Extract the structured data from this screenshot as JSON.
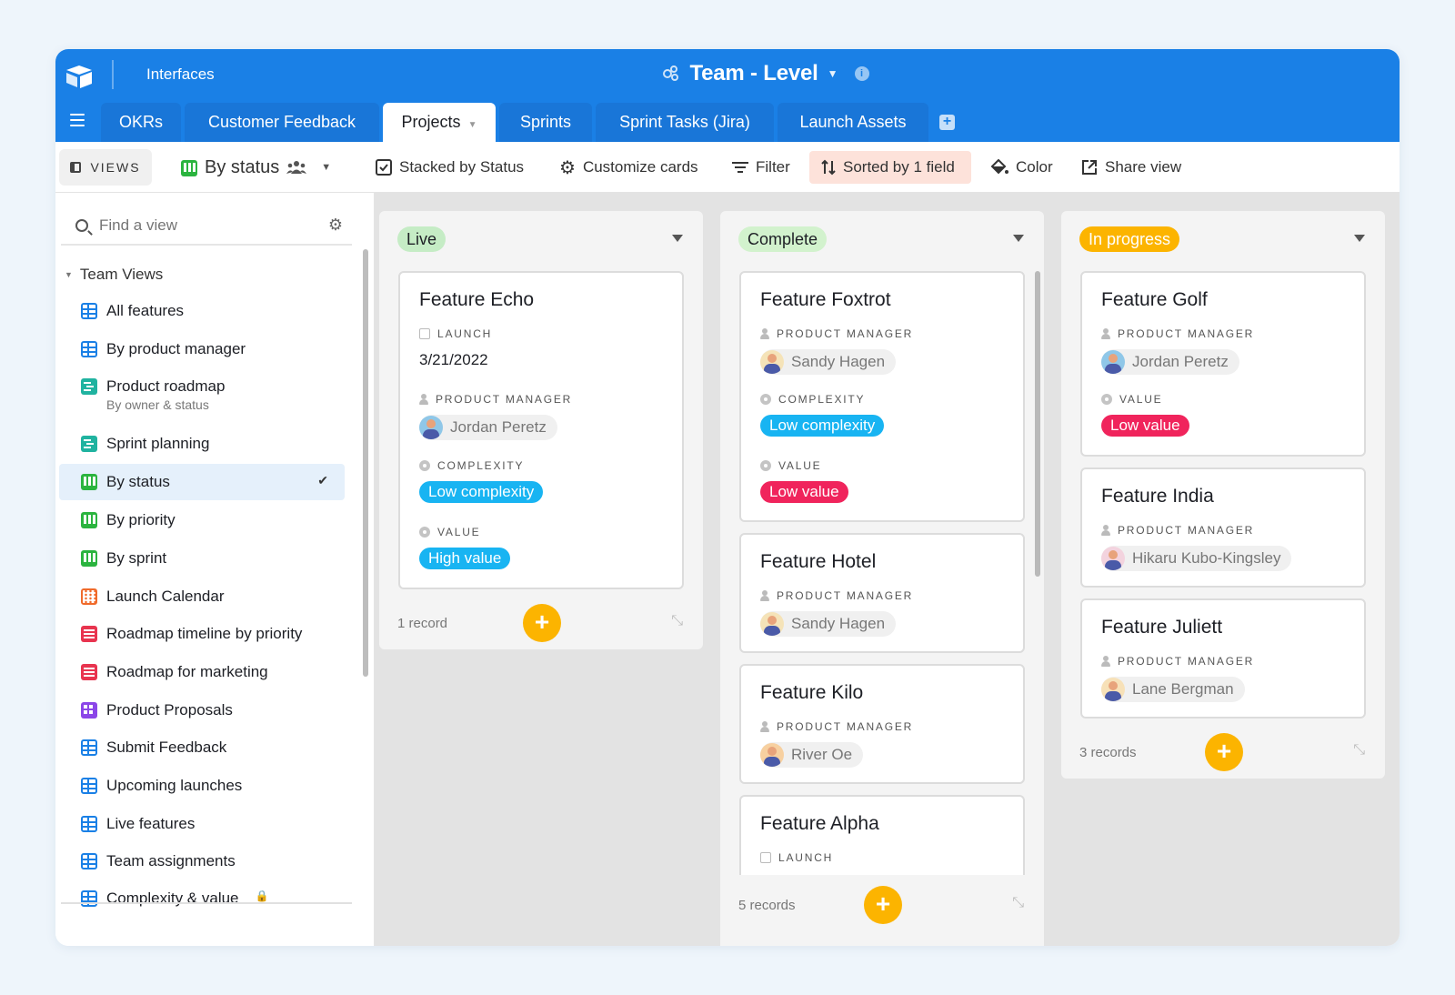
{
  "header": {
    "interfaces_label": "Interfaces",
    "base_title": "Team - Level",
    "info_glyph": "i"
  },
  "tabs": [
    {
      "label": "OKRs"
    },
    {
      "label": "Customer Feedback"
    },
    {
      "label": "Projects",
      "active": true
    },
    {
      "label": "Sprints"
    },
    {
      "label": "Sprint Tasks (Jira)"
    },
    {
      "label": "Launch Assets"
    }
  ],
  "toolbar": {
    "views_label": "VIEWS",
    "current_view": "By status",
    "stacked": "Stacked by Status",
    "customize": "Customize cards",
    "filter": "Filter",
    "sorted": "Sorted by 1 field",
    "color": "Color",
    "share": "Share view"
  },
  "sidebar": {
    "search_placeholder": "Find a view",
    "group_label": "Team Views",
    "items": [
      {
        "label": "All features",
        "icon": "grid-view-icon"
      },
      {
        "label": "By product manager",
        "icon": "grid-view-icon"
      },
      {
        "label": "Product roadmap",
        "sub": "By owner & status",
        "icon": "gantt-view-icon"
      },
      {
        "label": "Sprint planning",
        "icon": "gantt-view-icon"
      },
      {
        "label": "By status",
        "icon": "kanban-view-icon",
        "selected": true
      },
      {
        "label": "By priority",
        "icon": "kanban-view-icon"
      },
      {
        "label": "By sprint",
        "icon": "kanban-view-icon"
      },
      {
        "label": "Launch Calendar",
        "icon": "calendar-view-icon"
      },
      {
        "label": "Roadmap timeline by priority",
        "icon": "timeline-view-icon"
      },
      {
        "label": "Roadmap for marketing",
        "icon": "timeline-view-icon"
      },
      {
        "label": "Product Proposals",
        "icon": "form-view-icon"
      },
      {
        "label": "Submit Feedback",
        "icon": "grid-view-icon"
      },
      {
        "label": "Upcoming launches",
        "icon": "grid-view-icon"
      },
      {
        "label": "Live features",
        "icon": "grid-view-icon"
      },
      {
        "label": "Team assignments",
        "icon": "grid-view-icon"
      },
      {
        "label": "Complexity & value",
        "icon": "grid-view-icon",
        "locked": true
      }
    ]
  },
  "board": {
    "field_labels": {
      "launch": "LAUNCH",
      "pm": "PRODUCT MANAGER",
      "complexity": "COMPLEXITY",
      "value": "VALUE"
    },
    "columns": [
      {
        "status": "Live",
        "status_color": "#c5ecc5",
        "footer": "1 record",
        "cards": [
          {
            "title": "Feature Echo",
            "launch": "3/21/2022",
            "pm": "Jordan Peretz",
            "complexity": "Low complexity",
            "value": "High value"
          }
        ]
      },
      {
        "status": "Complete",
        "status_color": "#d2f2cd",
        "footer": "5 records",
        "cards": [
          {
            "title": "Feature Foxtrot",
            "pm": "Sandy Hagen",
            "complexity": "Low complexity",
            "value": "Low value"
          },
          {
            "title": "Feature Hotel",
            "pm": "Sandy Hagen"
          },
          {
            "title": "Feature Kilo",
            "pm": "River Oe"
          },
          {
            "title": "Feature Alpha"
          }
        ]
      },
      {
        "status": "In progress",
        "status_color": "#fcb400",
        "footer": "3 records",
        "cards": [
          {
            "title": "Feature Golf",
            "pm": "Jordan Peretz",
            "value": "Low value"
          },
          {
            "title": "Feature India",
            "pm": "Hikaru Kubo-Kingsley"
          },
          {
            "title": "Feature Juliett",
            "pm": "Lane Bergman"
          }
        ]
      }
    ]
  },
  "colors": {
    "header_blue": "#1a80e6",
    "complexity_tag": "#18b4f2",
    "high_value_tag": "#18b4f2",
    "low_value_tag": "#f0245c",
    "add_button": "#fcb400"
  }
}
